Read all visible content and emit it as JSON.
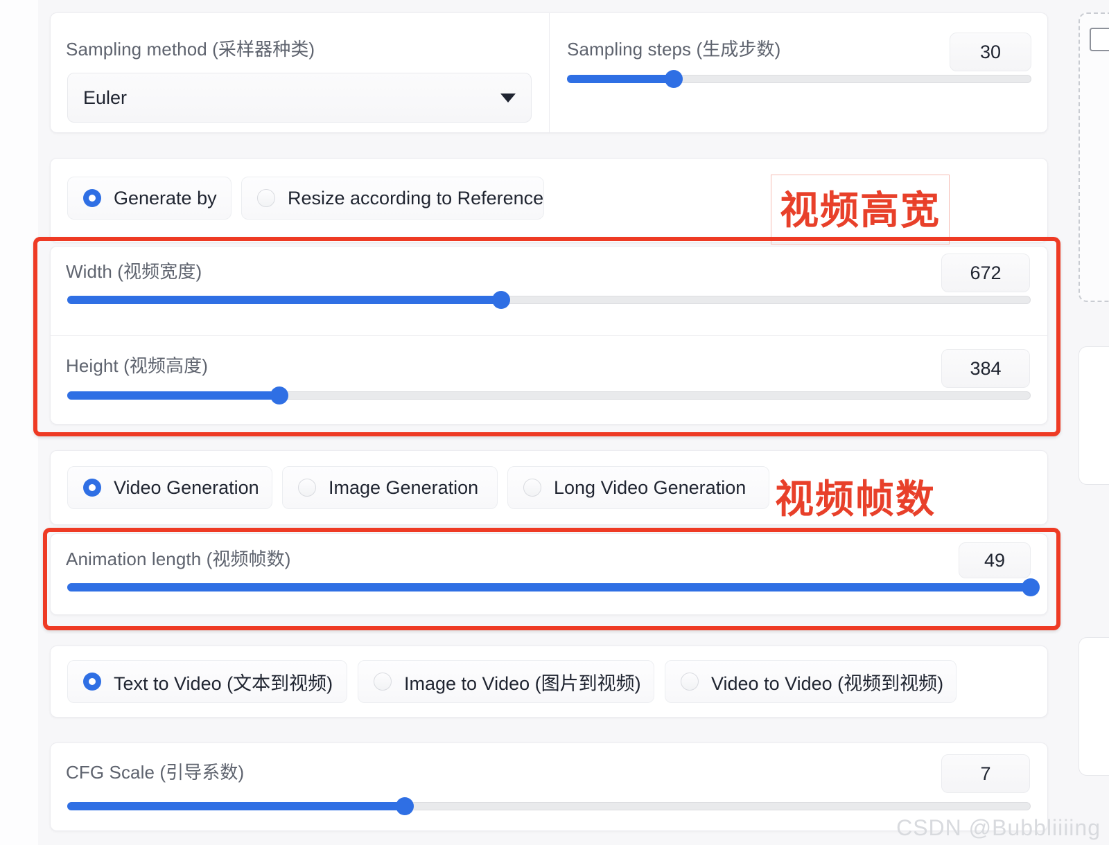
{
  "app": {
    "watermark": "CSDN @Bubbliiiing"
  },
  "sampling": {
    "method": {
      "label": "Sampling method (采样器种类)",
      "value": "Euler",
      "caret": "chevron-down-icon"
    },
    "steps": {
      "label": "Sampling steps (生成步数)",
      "value": "30",
      "percent": 23
    }
  },
  "size_mode": {
    "options": [
      {
        "label": "Generate by",
        "selected": true
      },
      {
        "label": "Resize according to Reference",
        "selected": false
      }
    ]
  },
  "size": {
    "width": {
      "label": "Width (视频宽度)",
      "value": "672",
      "percent": 45
    },
    "height": {
      "label": "Height (视频高度)",
      "value": "384",
      "percent": 22
    }
  },
  "generation_mode": {
    "options": [
      {
        "label": "Video Generation",
        "selected": true
      },
      {
        "label": "Image Generation",
        "selected": false
      },
      {
        "label": "Long Video Generation",
        "selected": false
      }
    ]
  },
  "animation": {
    "length": {
      "label": "Animation length (视频帧数)",
      "value": "49",
      "percent": 100
    }
  },
  "conversion_mode": {
    "options": [
      {
        "label": "Text to Video (文本到视频)",
        "selected": true
      },
      {
        "label": "Image to Video (图片到视频)",
        "selected": false
      },
      {
        "label": "Video to Video (视频到视频)",
        "selected": false
      }
    ]
  },
  "cfg": {
    "scale": {
      "label": "CFG Scale (引导系数)",
      "value": "7",
      "percent": 35
    }
  },
  "annotations": [
    {
      "text": "视频高宽",
      "target": "width-height-group"
    },
    {
      "text": "视频帧数",
      "target": "animation-length-group"
    }
  ],
  "colors": {
    "accent": "#2f6fe4",
    "annotation": "#e8402a",
    "panel": "#ffffff",
    "page": "#f7f7f9"
  }
}
